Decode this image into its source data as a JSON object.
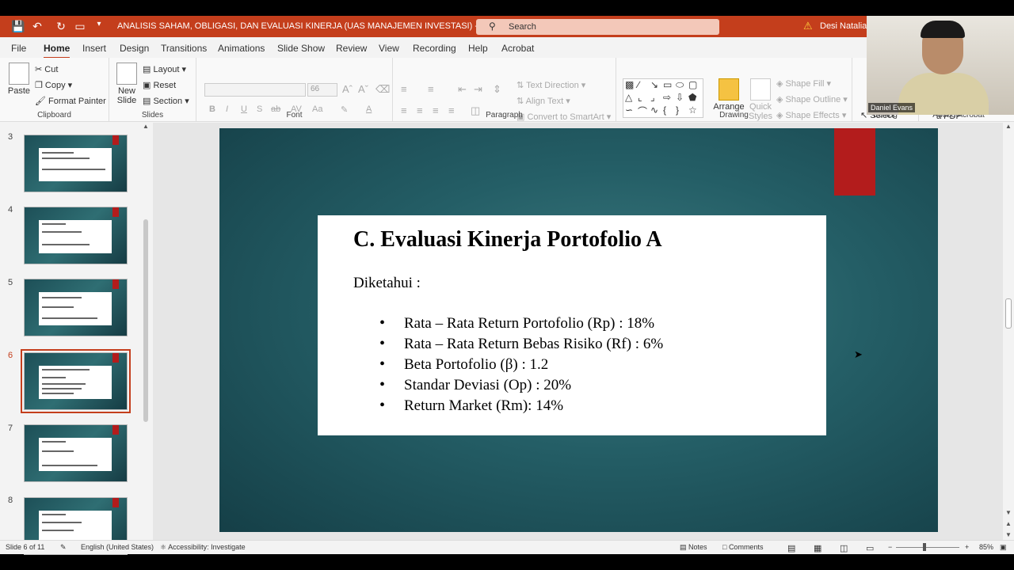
{
  "titlebar": {
    "doc_title": "ANALISIS SAHAM, OBLIGASI, DAN EVALUASI KINERJA (UAS MANAJEMEN INVESTASI)  -  PowerPoint",
    "search_placeholder": "Search",
    "user_name": "Desi Natalia"
  },
  "tabs": [
    "File",
    "Home",
    "Insert",
    "Design",
    "Transitions",
    "Animations",
    "Slide Show",
    "Review",
    "View",
    "Recording",
    "Help",
    "Acrobat"
  ],
  "ribbon": {
    "clipboard": {
      "paste": "Paste",
      "cut": "Cut",
      "copy": "Copy",
      "format_painter": "Format Painter",
      "label": "Clipboard"
    },
    "slides": {
      "new_slide": "New Slide",
      "layout": "Layout",
      "reset": "Reset",
      "section": "Section",
      "label": "Slides"
    },
    "font": {
      "size": "66",
      "label": "Font"
    },
    "paragraph": {
      "text_direction": "Text Direction",
      "align_text": "Align Text",
      "convert": "Convert to SmartArt",
      "label": "Paragraph"
    },
    "drawing": {
      "arrange": "Arrange",
      "quick_styles": "Quick Styles",
      "shape_fill": "Shape Fill",
      "shape_outline": "Shape Outline",
      "shape_effects": "Shape Effects",
      "label": "Drawing"
    },
    "editing": {
      "select": "Select",
      "label": "Editing"
    },
    "acrobat": {
      "pdf": "a PDF",
      "label": "Adobe Acrobat"
    }
  },
  "webcam": {
    "name": "Daniel Evans"
  },
  "thumbnails": [
    {
      "num": "3"
    },
    {
      "num": "4"
    },
    {
      "num": "5"
    },
    {
      "num": "6",
      "selected": true
    },
    {
      "num": "7"
    },
    {
      "num": "8"
    }
  ],
  "slide": {
    "title": "C. Evaluasi Kinerja Portofolio A",
    "known": "Diketahui :",
    "bullets": [
      "Rata – Rata Return Portofolio (Rp) : 18%",
      "Rata – Rata Return Bebas Risiko (Rf) : 6%",
      "Beta Portofolio (β) : 1.2",
      "Standar Deviasi (Op) : 20%",
      "Return Market (Rm): 14%"
    ]
  },
  "status": {
    "slide_info": "Slide 6 of 11",
    "language": "English (United States)",
    "accessibility": "Accessibility: Investigate",
    "notes": "Notes",
    "comments": "Comments",
    "zoom": "85%"
  },
  "colors": {
    "accent": "#c43e1c",
    "slide_red": "#b31c1c",
    "slide_bg": "#245e66"
  }
}
